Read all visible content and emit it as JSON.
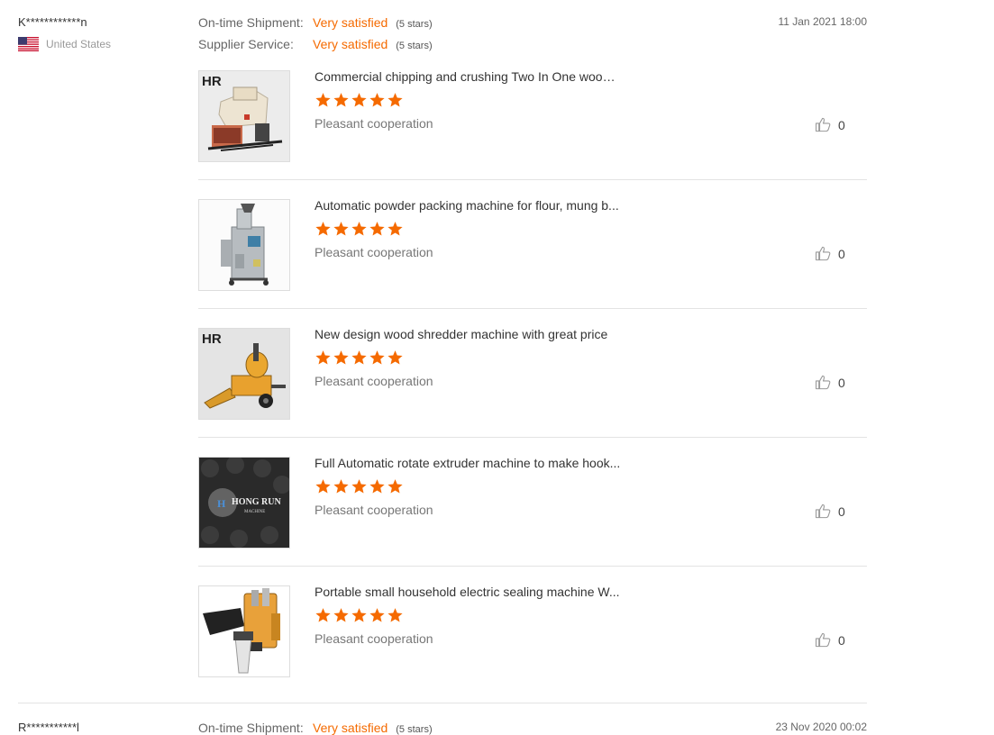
{
  "review1": {
    "reviewer": "K************n",
    "country": "United States",
    "flag_icon": "us-flag-icon",
    "ratings": [
      {
        "label": "On-time Shipment:",
        "value": "Very satisfied",
        "stars": "(5 stars)"
      },
      {
        "label": "Supplier Service:",
        "value": "Very satisfied",
        "stars": "(5 stars)"
      }
    ],
    "date": "11 Jan 2021 18:00",
    "products": [
      {
        "title": "Commercial chipping and crushing Two In One wood ...",
        "rating": 5,
        "comment": "Pleasant cooperation",
        "likes": "0",
        "image_icon": "wood-chipper-image",
        "brand": "HR"
      },
      {
        "title": "Automatic powder packing machine for flour, mung b...",
        "rating": 5,
        "comment": "Pleasant cooperation",
        "likes": "0",
        "image_icon": "packing-machine-image"
      },
      {
        "title": "New design wood shredder machine with great price",
        "rating": 5,
        "comment": "Pleasant cooperation",
        "likes": "0",
        "image_icon": "wood-shredder-image",
        "brand": "HR"
      },
      {
        "title": "Full Automatic rotate extruder machine to make hook...",
        "rating": 5,
        "comment": "Pleasant cooperation",
        "likes": "0",
        "image_icon": "hong-run-logo-image",
        "brand_text": "HONG RUN",
        "brand_sub": "MACHINE"
      },
      {
        "title": "Portable small household electric sealing machine W...",
        "rating": 5,
        "comment": "Pleasant cooperation",
        "likes": "0",
        "image_icon": "sealing-machine-image"
      }
    ]
  },
  "review2": {
    "reviewer": "R***********l",
    "rating_label": "On-time Shipment:",
    "rating_value": "Very satisfied",
    "rating_stars": "(5 stars)",
    "date": "23 Nov 2020 00:02"
  },
  "colors": {
    "accent": "#f56a00",
    "star": "#f56a00",
    "divider": "#e3e3e3"
  }
}
